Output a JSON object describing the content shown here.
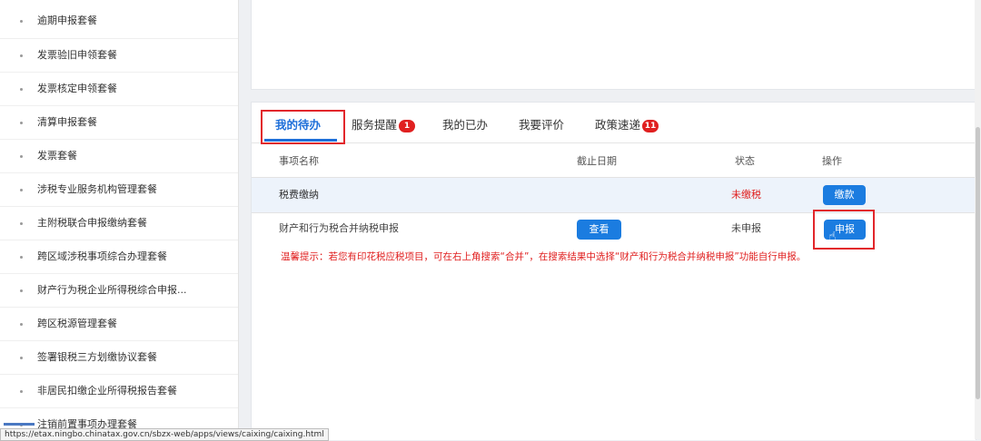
{
  "sidebar": {
    "items": [
      {
        "label": "逾期申报套餐"
      },
      {
        "label": "发票验旧申领套餐"
      },
      {
        "label": "发票核定申领套餐"
      },
      {
        "label": "清算申报套餐"
      },
      {
        "label": "发票套餐"
      },
      {
        "label": "涉税专业服务机构管理套餐"
      },
      {
        "label": "主附税联合申报缴纳套餐"
      },
      {
        "label": "跨区域涉税事项综合办理套餐"
      },
      {
        "label": "财产行为税企业所得税综合申报..."
      },
      {
        "label": "跨区税源管理套餐"
      },
      {
        "label": "签署银税三方划缴协议套餐"
      },
      {
        "label": "非居民扣缴企业所得税报告套餐"
      },
      {
        "label": "注销前置事项办理套餐"
      }
    ]
  },
  "tabs": [
    {
      "label": "我的待办"
    },
    {
      "label": "服务提醒",
      "badge": "1"
    },
    {
      "label": "我的已办"
    },
    {
      "label": "我要评价"
    },
    {
      "label": "政策速递",
      "badge": "11"
    }
  ],
  "table": {
    "headers": [
      "事项名称",
      "截止日期",
      "状态",
      "操作"
    ],
    "rows": [
      {
        "name": "税费缴纳",
        "deadline": "",
        "status": "未缴税",
        "action": "缴款"
      },
      {
        "name": "财产和行为税合并纳税申报",
        "deadline_button": "查看",
        "status": "未申报",
        "action": "申报"
      }
    ]
  },
  "tip": "温馨提示：若您有印花税应税项目，可在右上角搜索“合并”，在搜索结果中选择“财产和行为税合并纳税申报”功能自行申报。",
  "status_url": "https://etax.ningbo.chinatax.gov.cn/sbzx-web/apps/views/caixing/caixing.html",
  "colors": {
    "accent": "#1e6fd9",
    "button": "#1b7ce0",
    "alert": "#e02020",
    "highlight_box": "#e2262b"
  },
  "icons": {
    "bullet": "dot-icon",
    "cursor": "hand-pointer-icon"
  }
}
